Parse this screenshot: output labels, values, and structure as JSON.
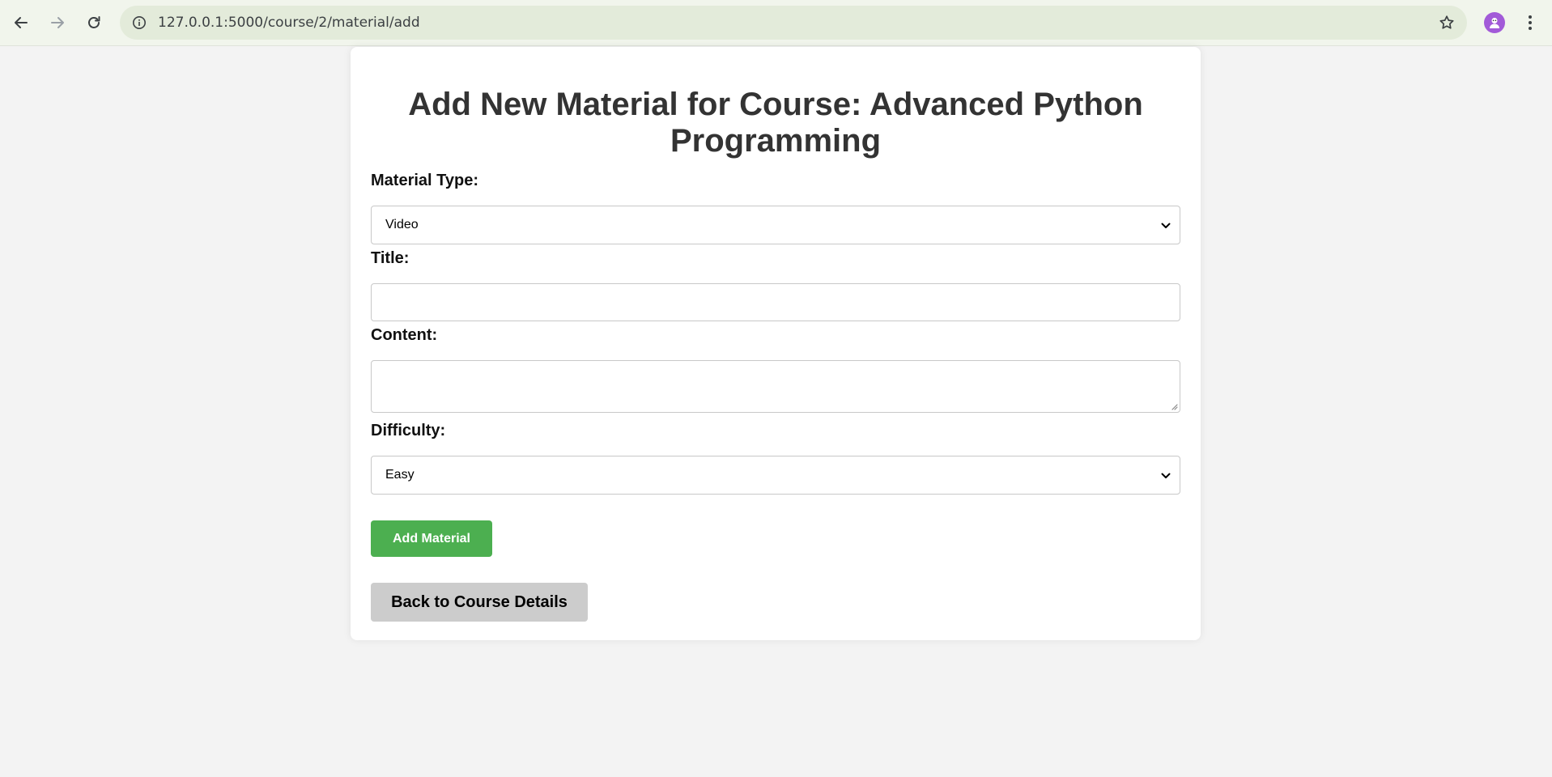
{
  "browser": {
    "url": "127.0.0.1:5000/course/2/material/add"
  },
  "page": {
    "title": "Add New Material for Course: Advanced Python Programming"
  },
  "form": {
    "material_type": {
      "label": "Material Type:",
      "selected": "Video"
    },
    "title": {
      "label": "Title:",
      "value": ""
    },
    "content": {
      "label": "Content:",
      "value": ""
    },
    "difficulty": {
      "label": "Difficulty:",
      "selected": "Easy"
    },
    "submit_label": "Add Material",
    "back_label": "Back to Course Details"
  },
  "icons": {
    "back": "arrow-left-icon",
    "forward": "arrow-right-icon",
    "reload": "reload-icon",
    "site_info": "info-icon",
    "bookmark": "star-icon",
    "profile": "avatar-icon",
    "menu": "kebab-menu-icon"
  },
  "colors": {
    "primary_button": "#4caf50",
    "secondary_button": "#cccccc",
    "page_background": "#f3f3f3",
    "title_text": "#333333",
    "avatar": "#a25ad8"
  }
}
